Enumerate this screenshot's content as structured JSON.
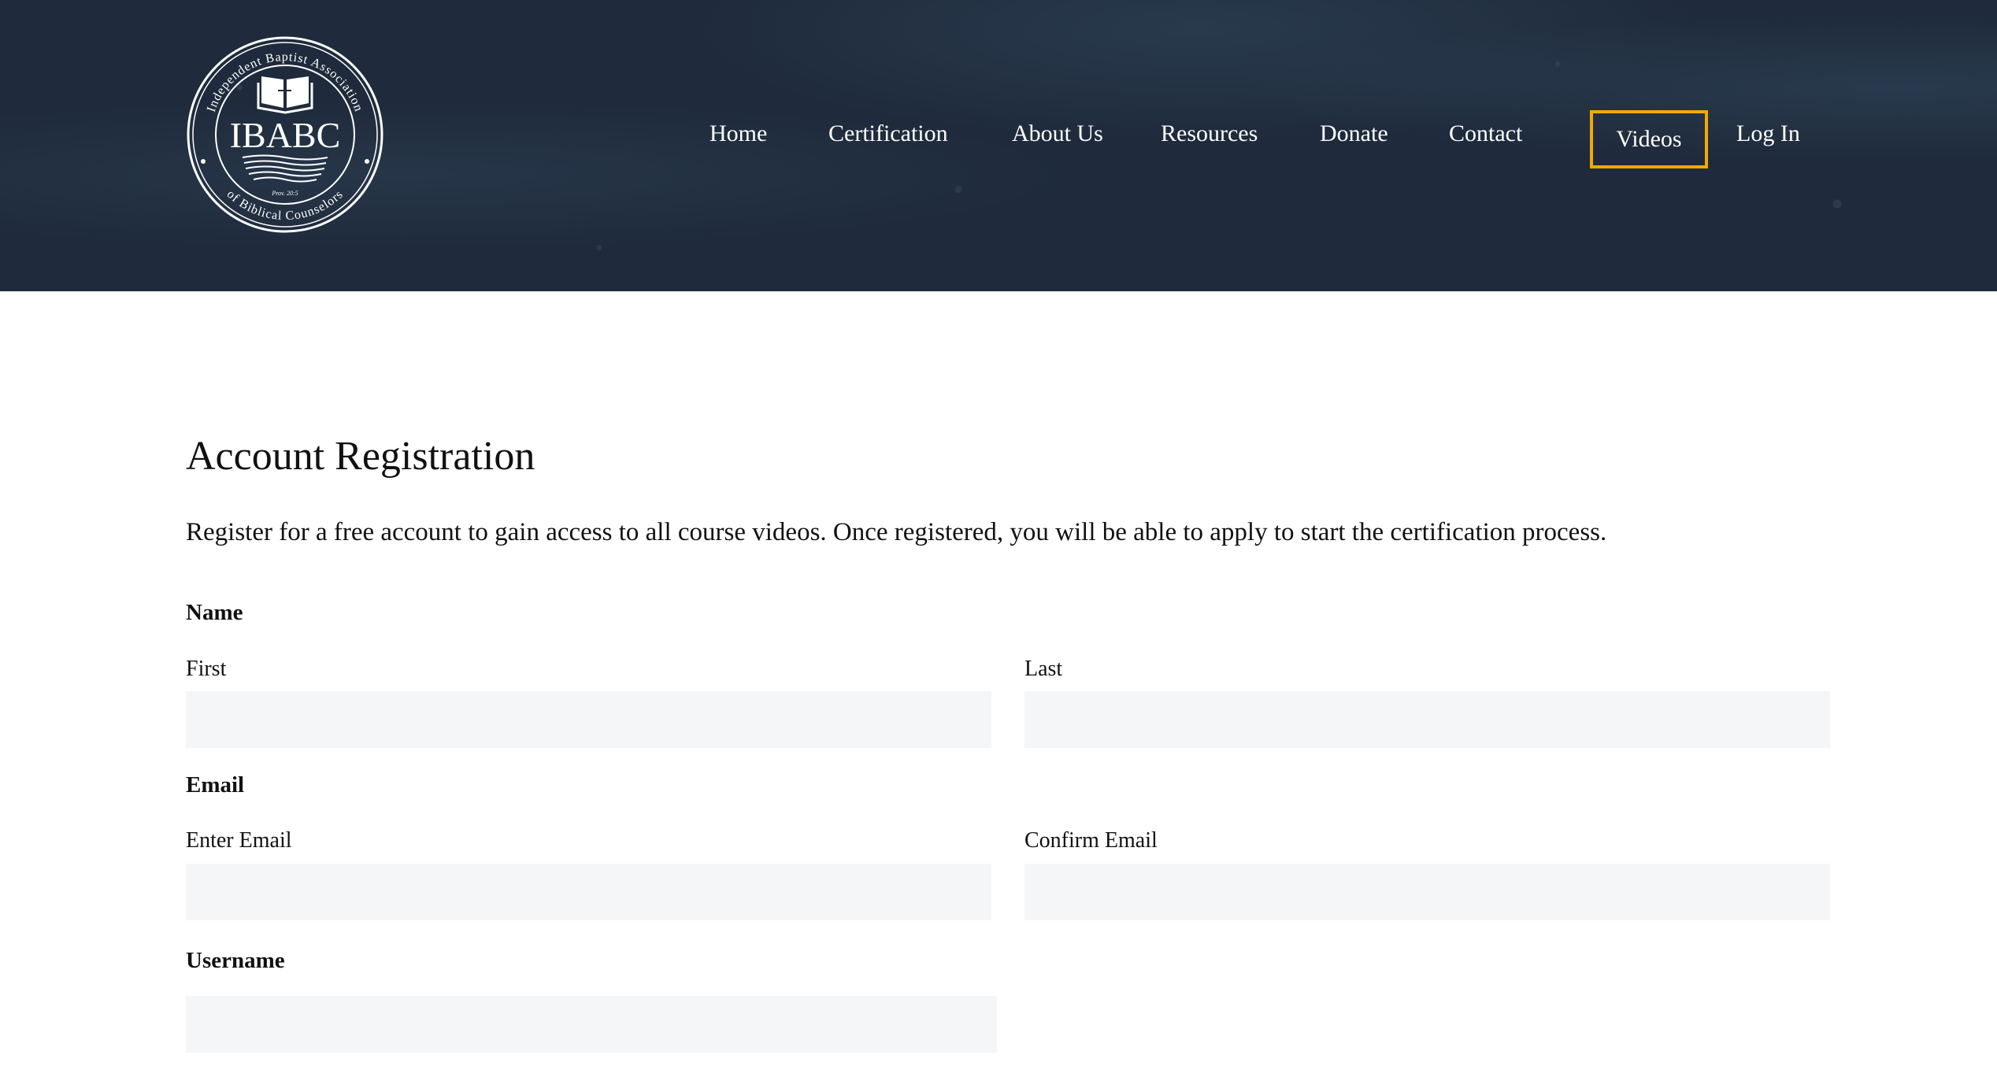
{
  "header": {
    "logo": {
      "abbreviation": "IBABC",
      "ring_text_top": "Independent Baptist Association",
      "ring_text_bottom": "of Biblical Counselors",
      "verse": "Prov. 20:5",
      "icon": "open-bible-cross-icon"
    },
    "nav": {
      "items": [
        {
          "label": "Home"
        },
        {
          "label": "Certification"
        },
        {
          "label": "About Us"
        },
        {
          "label": "Resources"
        },
        {
          "label": "Donate"
        },
        {
          "label": "Contact"
        },
        {
          "label": "Videos",
          "highlighted": true
        },
        {
          "label": "Log In"
        }
      ],
      "highlight_color": "#f5a800"
    },
    "background_color": "#1f2b3c"
  },
  "main": {
    "title": "Account Registration",
    "intro": "Register for a free account to gain access to all course videos. Once registered, you will be able to apply to start the certification process.",
    "form": {
      "name": {
        "label": "Name",
        "first": {
          "label": "First",
          "value": "",
          "placeholder": ""
        },
        "last": {
          "label": "Last",
          "value": "",
          "placeholder": ""
        }
      },
      "email": {
        "label": "Email",
        "enter": {
          "label": "Enter Email",
          "value": "",
          "placeholder": ""
        },
        "confirm": {
          "label": "Confirm Email",
          "value": "",
          "placeholder": ""
        }
      },
      "username": {
        "label": "Username",
        "value": "",
        "placeholder": ""
      }
    },
    "input_background": "#f5f6f8"
  }
}
